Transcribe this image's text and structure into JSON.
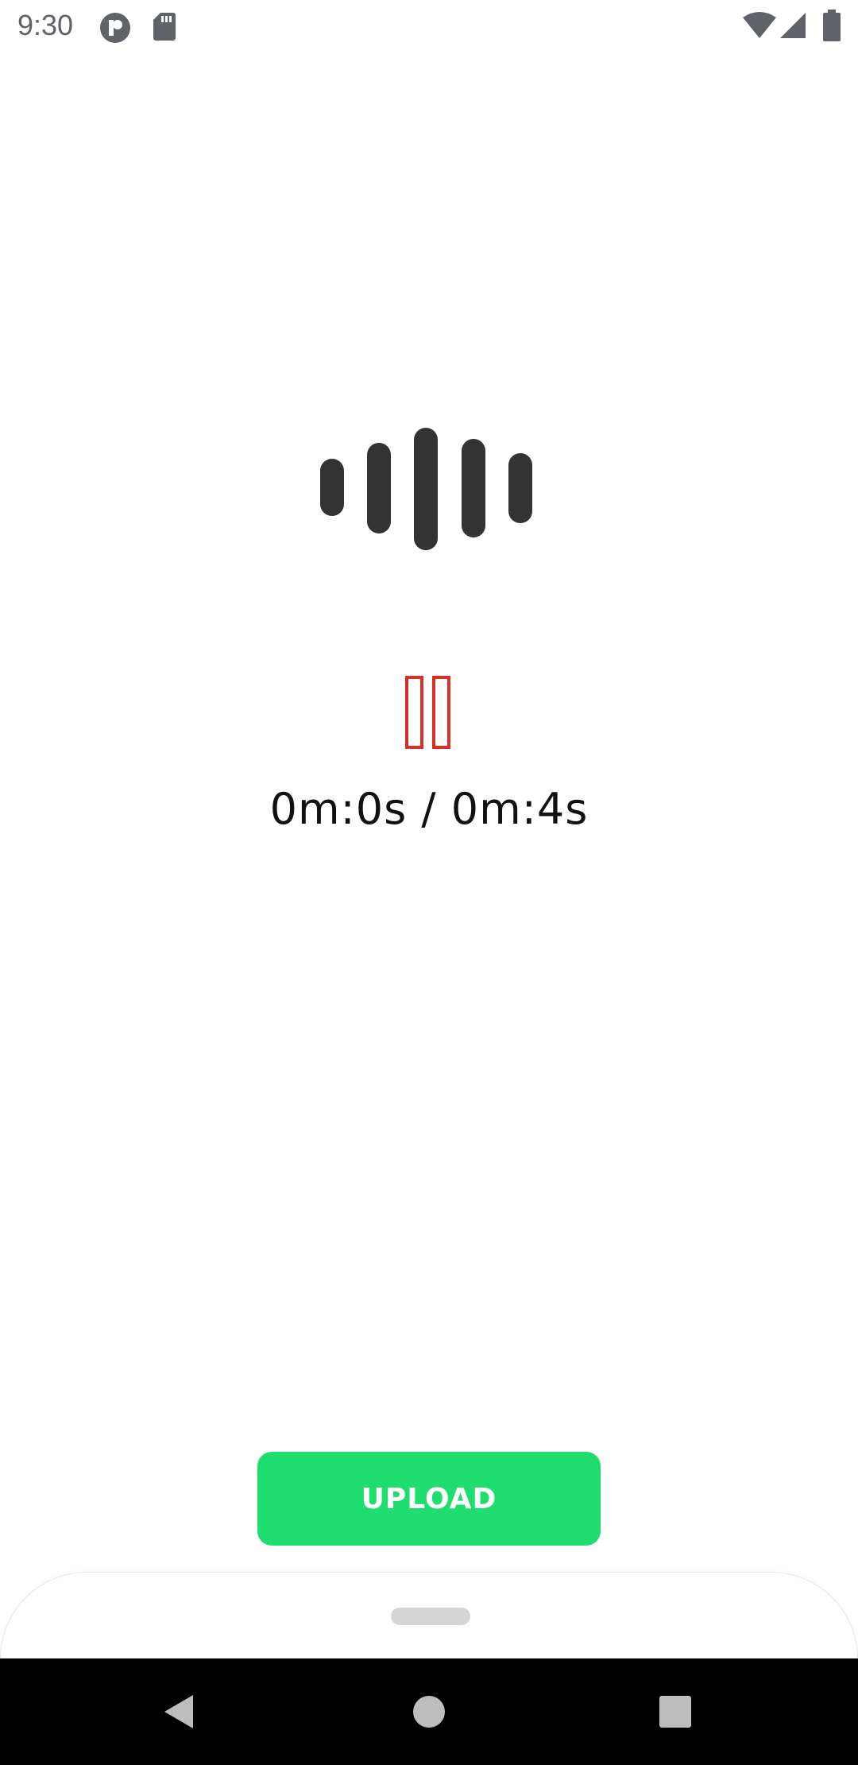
{
  "status_bar": {
    "time": "9:30",
    "left_icons": [
      "notification-app-icon",
      "sd-card-icon"
    ],
    "right_icons": [
      "wifi-icon",
      "cellular-signal-icon",
      "battery-icon"
    ]
  },
  "player": {
    "waveform_icon": "audio-waveform-icon",
    "pause_icon": "pause-icon",
    "time_readout": "0m:0s / 0m:4s",
    "accent_color": "#d93025"
  },
  "upload_button": {
    "label": "UPLOAD",
    "color": "#1fdd6e"
  },
  "bottom_sheet": {
    "handle": "drag-handle"
  },
  "nav_bar": {
    "buttons": [
      "back-icon",
      "home-icon",
      "recents-icon"
    ]
  }
}
